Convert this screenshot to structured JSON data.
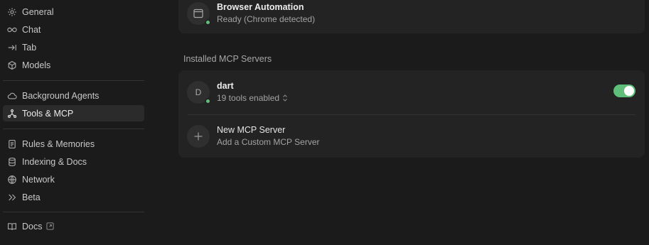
{
  "sidebar": {
    "items": [
      {
        "label": "General",
        "icon": "gear-icon"
      },
      {
        "label": "Chat",
        "icon": "infinity-icon"
      },
      {
        "label": "Tab",
        "icon": "tab-arrow-icon"
      },
      {
        "label": "Models",
        "icon": "cube-icon"
      },
      {
        "label": "Background Agents",
        "icon": "cloud-icon"
      },
      {
        "label": "Tools & MCP",
        "icon": "tools-icon",
        "active": true
      },
      {
        "label": "Rules & Memories",
        "icon": "document-icon"
      },
      {
        "label": "Indexing & Docs",
        "icon": "database-icon"
      },
      {
        "label": "Network",
        "icon": "globe-icon"
      },
      {
        "label": "Beta",
        "icon": "double-chevron-icon"
      },
      {
        "label": "Docs",
        "icon": "book-icon",
        "external": true
      }
    ]
  },
  "browser_card": {
    "title": "Browser Automation",
    "status": "Ready (Chrome detected)"
  },
  "mcp_section": {
    "label": "Installed MCP Servers",
    "servers": [
      {
        "initial": "D",
        "name": "dart",
        "tools": "19 tools enabled",
        "enabled": true
      }
    ],
    "new_server": {
      "title": "New MCP Server",
      "subtitle": "Add a Custom MCP Server"
    }
  },
  "colors": {
    "background": "#1b1b1b",
    "card": "#232323",
    "accent_green": "#5fbf7a",
    "active_item": "#2b2b2b"
  }
}
